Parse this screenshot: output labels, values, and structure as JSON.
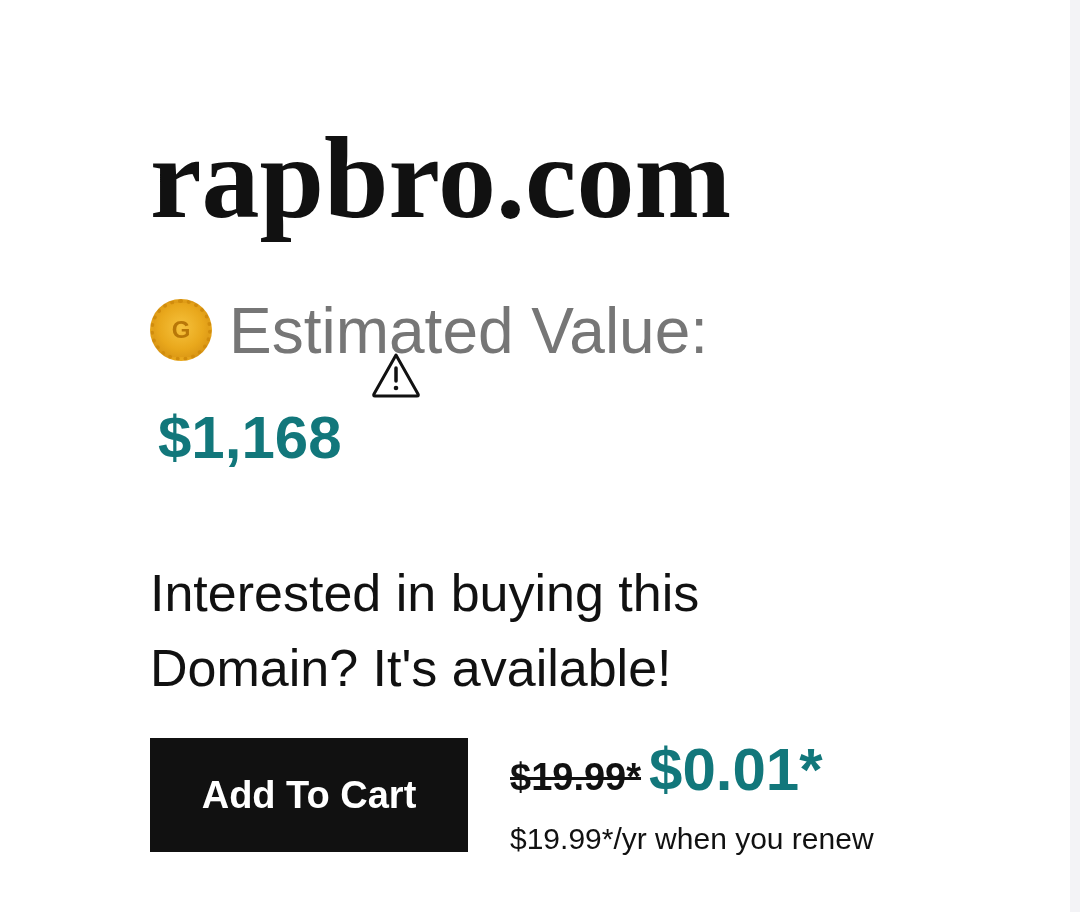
{
  "domain": {
    "name": "rapbro.com"
  },
  "estimate": {
    "logo_letter": "G",
    "label": "Estimated Value:",
    "value": "$1,168"
  },
  "offer": {
    "message": "Interested in buying this Domain? It's available!",
    "button": "Add To Cart",
    "old_price": "$19.99*",
    "price": "$0.01*",
    "renewal": "$19.99*/yr when you renew"
  }
}
